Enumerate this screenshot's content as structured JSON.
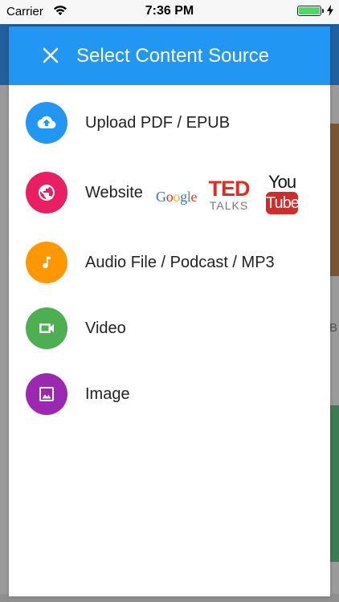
{
  "status_bar": {
    "carrier": "Carrier",
    "time": "7:36 PM",
    "battery_level": 1.0
  },
  "modal": {
    "title": "Select Content Source",
    "options": [
      {
        "label": "Upload PDF / EPUB",
        "icon": "cloud-upload-icon",
        "color": "#2196f3"
      },
      {
        "label": "Website",
        "icon": "globe-icon",
        "color": "#e91e63"
      },
      {
        "label": "Audio File / Podcast / MP3",
        "icon": "music-note-icon",
        "color": "#ff9800"
      },
      {
        "label": "Video",
        "icon": "video-camera-icon",
        "color": "#4caf50"
      },
      {
        "label": "Image",
        "icon": "image-icon",
        "color": "#9c27b0"
      }
    ],
    "website_logos": {
      "google": "Google",
      "ted": "TED",
      "ted_sub": "TALKS",
      "youtube_top": "You",
      "youtube_bottom": "Tube"
    }
  },
  "background": {
    "edge_letter": "B"
  },
  "colors": {
    "header": "#2196f3",
    "upload": "#2196f3",
    "website": "#e91e63",
    "audio": "#ff9800",
    "video": "#4caf50",
    "image": "#9c27b0"
  }
}
